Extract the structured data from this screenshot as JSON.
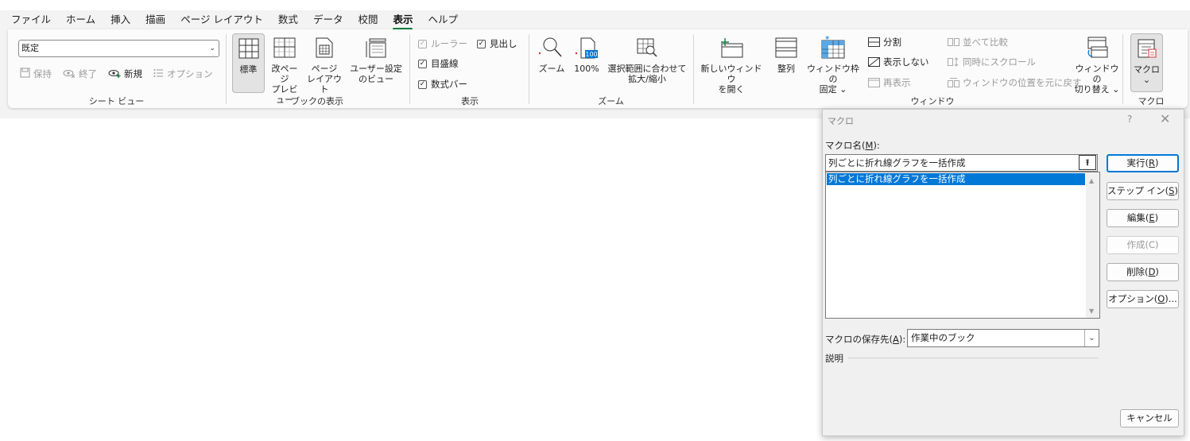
{
  "menu": {
    "tabs": [
      "ファイル",
      "ホーム",
      "挿入",
      "描画",
      "ページ レイアウト",
      "数式",
      "データ",
      "校閲",
      "表示",
      "ヘルプ"
    ],
    "active_tab": "表示"
  },
  "ribbon": {
    "sheet_view": {
      "select_value": "既定",
      "keep": "保持",
      "exit": "終了",
      "new": "新規",
      "options": "オプション",
      "label": "シート ビュー"
    },
    "workbook_views": {
      "normal": "標準",
      "page_break_1": "改ページ",
      "page_break_2": "プレビュー",
      "page_layout_1": "ページ",
      "page_layout_2": "レイアウト",
      "custom_1": "ユーザー設定",
      "custom_2": "のビュー",
      "label": "ブックの表示"
    },
    "show": {
      "ruler": "ルーラー",
      "gridlines": "目盛線",
      "formula_bar": "数式バー",
      "headings": "見出し",
      "label": "表示"
    },
    "zoom": {
      "zoom": "ズーム",
      "zoom100": "100%",
      "zoom100_icon": "100",
      "selection_1": "選択範囲に合わせて",
      "selection_2": "拡大/縮小",
      "label": "ズーム"
    },
    "window": {
      "new_window_1": "新しいウィンドウ",
      "new_window_2": "を開く",
      "arrange": "整列",
      "freeze_1": "ウィンドウ枠の",
      "freeze_2": "固定",
      "split": "分割",
      "hide": "表示しない",
      "unhide": "再表示",
      "side_by_side": "並べて比較",
      "sync_scroll": "同時にスクロール",
      "reset_position": "ウィンドウの位置を元に戻す",
      "switch_1": "ウィンドウの",
      "switch_2": "切り替え",
      "label": "ウィンドウ"
    },
    "macros": {
      "macro": "マクロ",
      "label": "マクロ"
    }
  },
  "dialog": {
    "title": "マクロ",
    "help": "?",
    "close": "✕",
    "macro_name_label": "マクロ名(",
    "macro_name_key": "M",
    "macro_name_label_end": "):",
    "macro_name_value": "列ごとに折れ線グラフを一括作成",
    "list_items": [
      "列ごとに折れ線グラフを一括作成"
    ],
    "buttons": {
      "run": "実行(",
      "run_key": "R",
      "step_into": "ステップ イン(",
      "step_into_key": "S",
      "edit": "編集(",
      "edit_key": "E",
      "create": "作成(C)",
      "delete": "削除(",
      "delete_key": "D",
      "options": "オプション(",
      "options_key": "O",
      "options_end": ")...",
      "close_paren": ")",
      "cancel": "キャンセル"
    },
    "store_label": "マクロの保存先(",
    "store_key": "A",
    "store_label_end": "):",
    "store_value": "作業中のブック",
    "description_label": "説明"
  }
}
